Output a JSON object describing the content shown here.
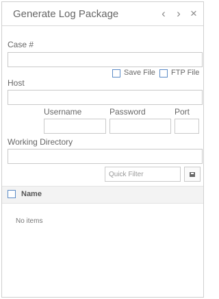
{
  "panel": {
    "title": "Generate Log Package"
  },
  "header_icons": {
    "prev": "‹",
    "next": "›",
    "close": "×"
  },
  "fields": {
    "case_label": "Case #",
    "save_file_label": "Save File",
    "ftp_file_label": "FTP File",
    "host_label": "Host",
    "username_label": "Username",
    "password_label": "Password",
    "port_label": "Port",
    "working_dir_label": "Working Directory"
  },
  "filter": {
    "placeholder": "Quick Filter"
  },
  "table": {
    "columns": [
      "Name"
    ],
    "empty_text": "No items"
  },
  "icons": [
    "chevron-left-icon",
    "chevron-right-icon",
    "close-icon",
    "floppy-disk-icon"
  ]
}
